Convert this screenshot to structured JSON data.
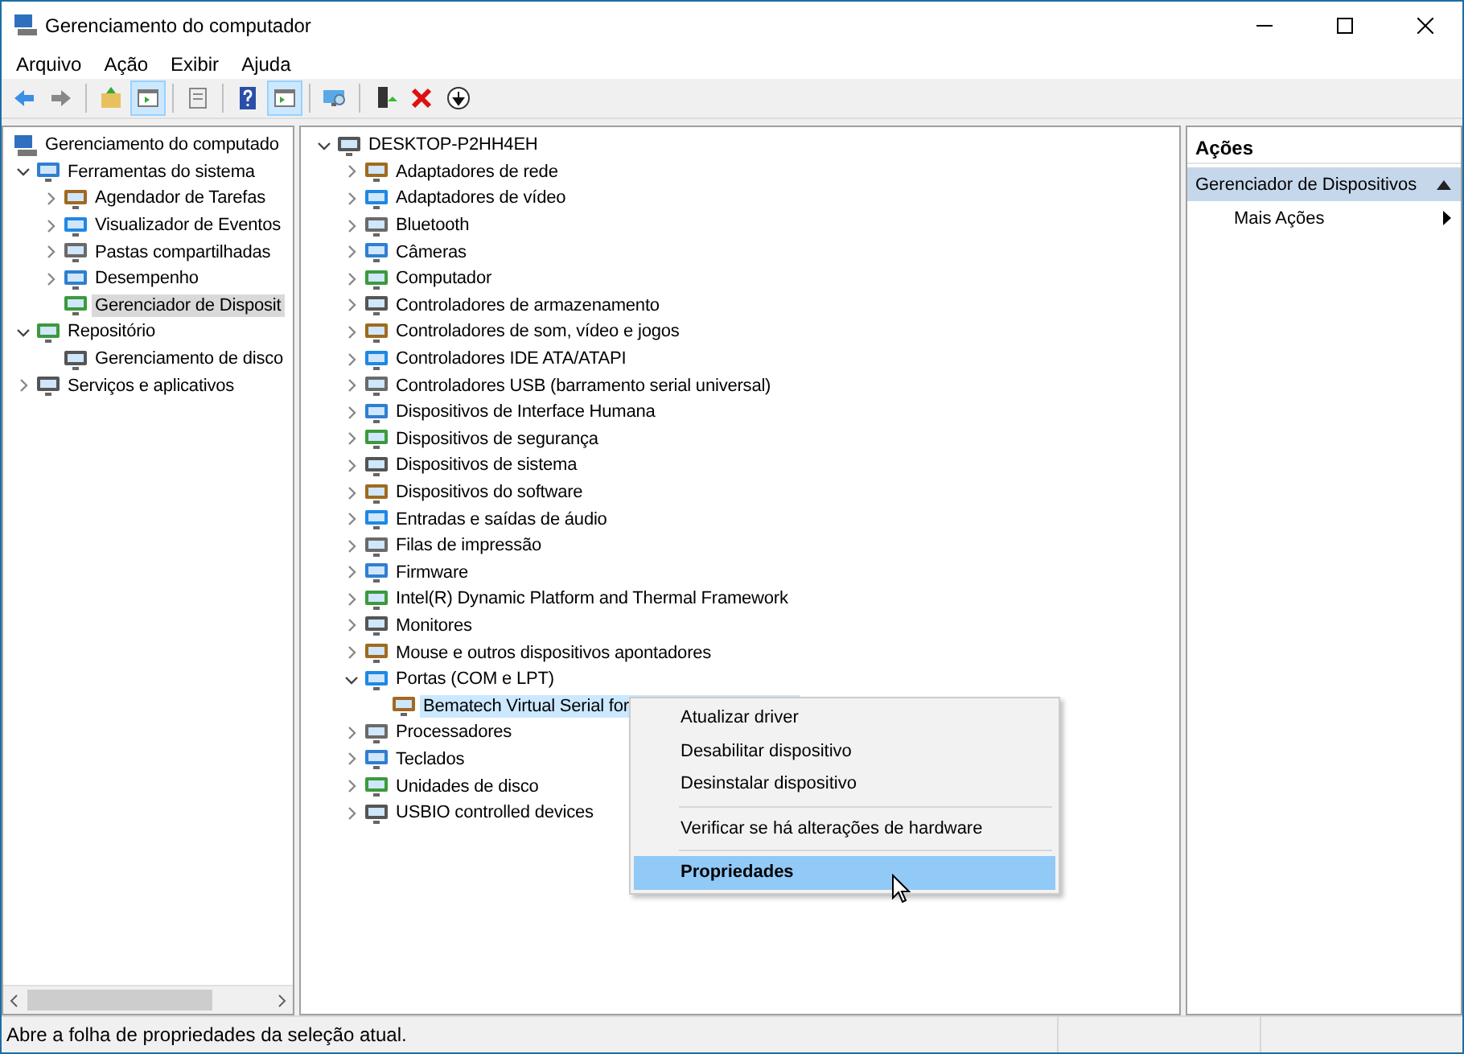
{
  "window": {
    "title": "Gerenciamento do computador"
  },
  "menu": [
    "Arquivo",
    "Ação",
    "Exibir",
    "Ajuda"
  ],
  "toolbar": [
    {
      "kind": "back",
      "pressed": false
    },
    {
      "kind": "forward",
      "pressed": false
    },
    {
      "kind": "separator"
    },
    {
      "kind": "folder-up",
      "pressed": false
    },
    {
      "kind": "tree-pane",
      "pressed": true
    },
    {
      "kind": "separator"
    },
    {
      "kind": "sheet",
      "pressed": false
    },
    {
      "kind": "separator"
    },
    {
      "kind": "help",
      "pressed": false
    },
    {
      "kind": "action-pane",
      "pressed": true
    },
    {
      "kind": "separator"
    },
    {
      "kind": "monitor",
      "pressed": false
    },
    {
      "kind": "separator"
    },
    {
      "kind": "enable",
      "pressed": false
    },
    {
      "kind": "delete",
      "pressed": false
    },
    {
      "kind": "download",
      "pressed": false
    }
  ],
  "console_tree": {
    "label": "Gerenciamento do computado",
    "selected": false,
    "children": [
      {
        "label": "Ferramentas do sistema",
        "expanded": true,
        "selected": false,
        "children": [
          {
            "label": "Agendador de Tarefas",
            "expanded": false,
            "selected": false
          },
          {
            "label": "Visualizador de Eventos",
            "expanded": false,
            "selected": false
          },
          {
            "label": "Pastas compartilhadas",
            "expanded": false,
            "selected": false
          },
          {
            "label": "Desempenho",
            "expanded": false,
            "selected": false
          },
          {
            "label": "Gerenciador de Disposit",
            "selected": true
          }
        ]
      },
      {
        "label": "Repositório",
        "expanded": true,
        "selected": false,
        "children": [
          {
            "label": "Gerenciamento de disco",
            "selected": false
          }
        ]
      },
      {
        "label": "Serviços e aplicativos",
        "expanded": false,
        "selected": false
      }
    ]
  },
  "device_tree": [
    {
      "label": "DESKTOP-P2HH4EH",
      "expanded": true,
      "selected": false,
      "children": [
        {
          "label": "Adaptadores de rede",
          "expanded": false,
          "selected": false
        },
        {
          "label": "Adaptadores de vídeo",
          "expanded": false,
          "selected": false
        },
        {
          "label": "Bluetooth",
          "expanded": false,
          "selected": false
        },
        {
          "label": "Câmeras",
          "expanded": false,
          "selected": false
        },
        {
          "label": "Computador",
          "expanded": false,
          "selected": false
        },
        {
          "label": "Controladores de armazenamento",
          "expanded": false,
          "selected": false
        },
        {
          "label": "Controladores de som, vídeo e jogos",
          "expanded": false,
          "selected": false
        },
        {
          "label": "Controladores IDE ATA/ATAPI",
          "expanded": false,
          "selected": false
        },
        {
          "label": "Controladores USB (barramento serial universal)",
          "expanded": false,
          "selected": false
        },
        {
          "label": "Dispositivos de Interface Humana",
          "expanded": false,
          "selected": false
        },
        {
          "label": "Dispositivos de segurança",
          "expanded": false,
          "selected": false
        },
        {
          "label": "Dispositivos de sistema",
          "expanded": false,
          "selected": false
        },
        {
          "label": "Dispositivos do software",
          "expanded": false,
          "selected": false
        },
        {
          "label": "Entradas e saídas de áudio",
          "expanded": false,
          "selected": false
        },
        {
          "label": "Filas de impressão",
          "expanded": false,
          "selected": false
        },
        {
          "label": "Firmware",
          "expanded": false,
          "selected": false
        },
        {
          "label": "Intel(R) Dynamic Platform and Thermal Framework",
          "expanded": false,
          "selected": false
        },
        {
          "label": "Monitores",
          "expanded": false,
          "selected": false
        },
        {
          "label": "Mouse e outros dispositivos apontadores",
          "expanded": false,
          "selected": false
        },
        {
          "label": "Portas (COM e LPT)",
          "expanded": true,
          "selected": false,
          "children": [
            {
              "label": "Bematech Virtual Serial for",
              "selected": true
            }
          ]
        },
        {
          "label": "Processadores",
          "expanded": false,
          "selected": false
        },
        {
          "label": "Teclados",
          "expanded": false,
          "selected": false
        },
        {
          "label": "Unidades de disco",
          "expanded": false,
          "selected": false
        },
        {
          "label": "USBIO controlled devices",
          "expanded": false,
          "selected": false
        }
      ]
    }
  ],
  "context_menu": [
    {
      "kind": "item",
      "label": "Atualizar driver",
      "selected": false,
      "default": false
    },
    {
      "kind": "item",
      "label": "Desabilitar dispositivo",
      "selected": false,
      "default": false
    },
    {
      "kind": "item",
      "label": "Desinstalar dispositivo",
      "selected": false,
      "default": false
    },
    {
      "kind": "separator"
    },
    {
      "kind": "item",
      "label": "Verificar se há alterações de hardware",
      "selected": false,
      "default": false
    },
    {
      "kind": "separator"
    },
    {
      "kind": "item",
      "label": "Propriedades",
      "selected": true,
      "default": true
    }
  ],
  "actions_pane": {
    "title": "Ações",
    "section": "Gerenciador de Dispositivos",
    "items": [
      "Mais Ações"
    ]
  },
  "status_bar": "Abre a folha de propriedades da seleção atual."
}
